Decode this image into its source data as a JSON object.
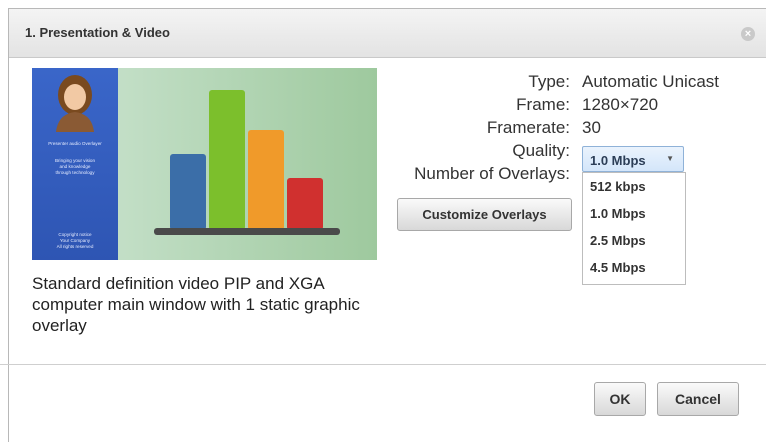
{
  "dialog": {
    "title": "1. Presentation & Video",
    "close_icon": "close-icon"
  },
  "preview": {
    "sidebar_lines": [
      "Presenter audio Overlayer",
      "Bringing your vision",
      "and knowledge",
      "through technology",
      "Copyright notice",
      "Your Company",
      "All rights reserved"
    ],
    "caption": "Standard definition video PIP and XGA computer main window with 1 static graphic overlay",
    "colors": {
      "sidebar": "#2e55b3",
      "bar1": "#3b6ea8",
      "bar2": "#7cbf2c",
      "bar3": "#f09a2a",
      "bar4": "#d0302f"
    }
  },
  "properties": {
    "type_label": "Type:",
    "type_value": "Automatic Unicast",
    "frame_label": "Frame:",
    "frame_value": "1280×720",
    "framerate_label": "Framerate:",
    "framerate_value": "30",
    "quality_label": "Quality:",
    "quality_selected": "1.0 Mbps",
    "overlays_label": "Number of Overlays:"
  },
  "quality_options": [
    "512 kbps",
    "1.0 Mbps",
    "2.5 Mbps",
    "4.5 Mbps"
  ],
  "buttons": {
    "customize": "Customize Overlays",
    "ok": "OK",
    "cancel": "Cancel"
  }
}
